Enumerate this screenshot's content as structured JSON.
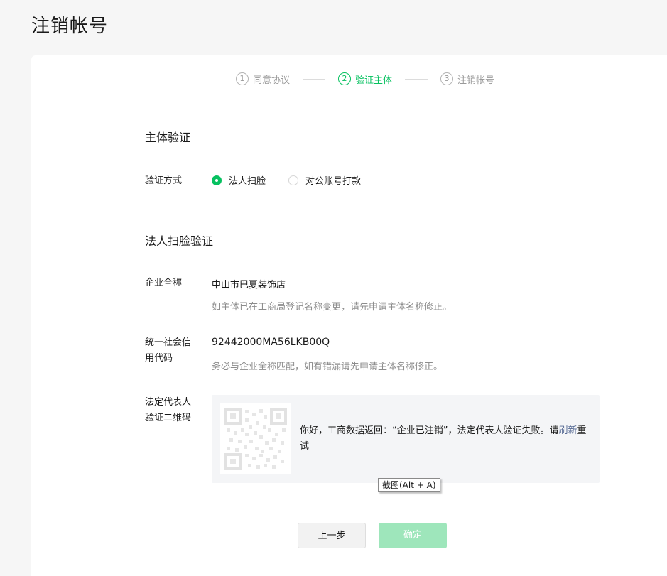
{
  "page": {
    "title": "注销帐号"
  },
  "steps": [
    {
      "num": "1",
      "label": "同意协议"
    },
    {
      "num": "2",
      "label": "验证主体"
    },
    {
      "num": "3",
      "label": "注销帐号"
    }
  ],
  "subject_verify": {
    "title": "主体验证",
    "method_label": "验证方式",
    "options": [
      "法人扫脸",
      "对公账号打款"
    ]
  },
  "scan_verify": {
    "title": "法人扫脸验证",
    "company_label": "企业全称",
    "company_name": "中山市巴夏装饰店",
    "company_hint": "如主体已在工商局登记名称变更，请先申请主体名称修正。",
    "credit_label_line1": "统一社会信",
    "credit_label_line2": "用代码",
    "credit_code": "92442000MA56LKB00Q",
    "credit_hint": "务必与企业全称匹配，如有错漏请先申请主体名称修正。",
    "qr_label_line1": "法定代表人",
    "qr_label_line2": "验证二维码",
    "qr_message": "你好，工商数据返回：“企业已注销”，法定代表人验证失败。请",
    "qr_link": "刷新",
    "qr_message_end": "重试"
  },
  "tooltip": {
    "text": "截图(Alt + A)"
  },
  "buttons": {
    "prev": "上一步",
    "confirm": "确定"
  },
  "colors": {
    "accent": "#07c160",
    "accent_disabled": "#9ee6bb",
    "link": "#576b95"
  }
}
